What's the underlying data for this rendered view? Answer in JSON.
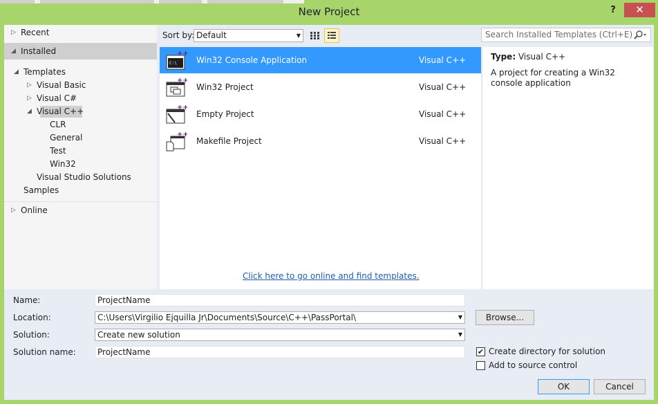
{
  "window": {
    "title": "New Project",
    "help": "?",
    "close": "✕"
  },
  "tree": {
    "recent": "Recent",
    "installed": "Installed",
    "templates": "Templates",
    "visual_basic": "Visual Basic",
    "visual_csharp": "Visual C#",
    "visual_cpp": "Visual C++",
    "clr": "CLR",
    "general": "General",
    "test": "Test",
    "win32": "Win32",
    "vs_solutions": "Visual Studio Solutions",
    "samples": "Samples",
    "online": "Online"
  },
  "toolbar": {
    "sort_label": "Sort by:",
    "sort_value": "Default",
    "search_placeholder": "Search Installed Templates (Ctrl+E)"
  },
  "templates": [
    {
      "name": "Win32 Console Application",
      "lang": "Visual C++",
      "icon": "console-app-icon"
    },
    {
      "name": "Win32 Project",
      "lang": "Visual C++",
      "icon": "win32-project-icon"
    },
    {
      "name": "Empty Project",
      "lang": "Visual C++",
      "icon": "empty-project-icon"
    },
    {
      "name": "Makefile Project",
      "lang": "Visual C++",
      "icon": "makefile-project-icon"
    }
  ],
  "online_link": "Click here to go online and find templates.",
  "detail": {
    "type_label": "Type:",
    "type_value": "Visual C++",
    "description": "A project for creating a Win32 console application"
  },
  "form": {
    "name_label": "Name:",
    "name_value": "ProjectName",
    "location_label": "Location:",
    "location_value": "C:\\Users\\Virgilio Ejquilla Jr\\Documents\\Source\\C++\\PassPortal\\",
    "solution_label": "Solution:",
    "solution_value": "Create new solution",
    "solution_name_label": "Solution name:",
    "solution_name_value": "ProjectName",
    "browse": "Browse...",
    "create_dir": "Create directory for solution",
    "create_dir_checked": true,
    "add_source_control": "Add to source control",
    "add_source_control_checked": false,
    "ok": "OK",
    "cancel": "Cancel"
  },
  "colors": {
    "frame": "#a8d46c",
    "selection": "#3399ff",
    "close": "#c75050",
    "link": "#1e5eb0"
  }
}
